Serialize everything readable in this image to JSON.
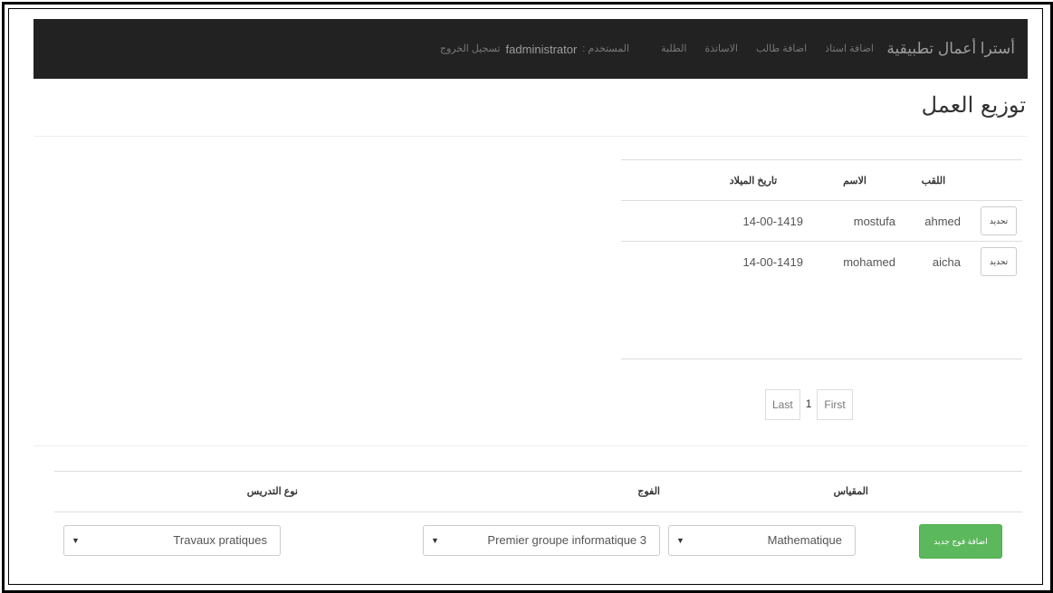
{
  "navbar": {
    "brand": "أسترا أعمال تطبيقية",
    "items": [
      "اضافة استاذ",
      "اضافة طالب",
      "الاساتذة",
      "الطلبة"
    ],
    "user_label": "المستخدم :",
    "user_name": "fadministrator",
    "logout": "تسجيل الخروج"
  },
  "page": {
    "title": "توزيع العمل"
  },
  "table": {
    "headers": {
      "last_name": "اللقب",
      "first_name": "الاسم",
      "birth_date": "تاريخ الميلاد"
    },
    "rows": [
      {
        "edit": "تحديد",
        "last_name": "ahmed",
        "first_name": "mostufa",
        "birth_date": "14-00-1419"
      },
      {
        "edit": "تحديد",
        "last_name": "aicha",
        "first_name": "mohamed",
        "birth_date": "14-00-1419"
      }
    ]
  },
  "pagination": {
    "last": "Last",
    "current": "1",
    "first": "First"
  },
  "form": {
    "headers": {
      "module": "المقياس",
      "group": "الفوج",
      "type": "نوع التدريس"
    },
    "module_value": "Mathematique",
    "group_value": "Premier groupe informatique 3",
    "type_value": "Travaux pratiques",
    "add_button": "اضافة فوج جديد"
  },
  "colors": {
    "navbar": "#222222",
    "add_button": "#5cb85c"
  }
}
